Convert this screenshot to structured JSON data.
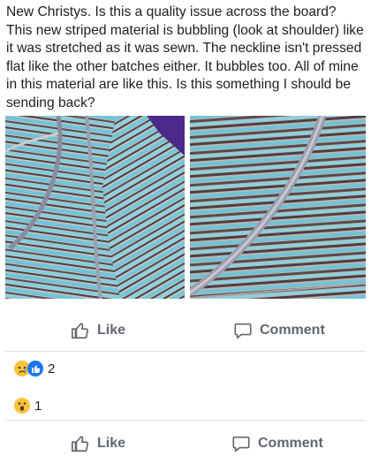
{
  "post": {
    "text": "New Christys. Is this a quality issue across the board? This new striped material is bubbling (look at shoulder) like it was stretched as it was sewn. The neckline isn't pressed flat like the other batches either. It bubbles too. All of mine in this material are like this. Is this something I should be sending back?"
  },
  "photos": [
    {
      "icon": "striped-shirt-shoulder-photo"
    },
    {
      "icon": "striped-shirt-neckline-photo"
    }
  ],
  "actions_top": {
    "like": "Like",
    "comment": "Comment"
  },
  "reactions": [
    {
      "icons": [
        "sad-reaction-icon",
        "like-reaction-icon"
      ],
      "count": "2"
    },
    {
      "icons": [
        "wow-reaction-icon"
      ],
      "count": "1"
    }
  ],
  "actions_bottom": {
    "like": "Like",
    "comment": "Comment"
  },
  "colors": {
    "text": "#1c1e21",
    "secondary": "#606770",
    "divider": "#dddfe2",
    "like_blue": "#1877f2",
    "stripe_teal": "#6fc3d6",
    "stripe_brown": "#5a4a4c",
    "stripe_grey": "#b9b4b6"
  }
}
